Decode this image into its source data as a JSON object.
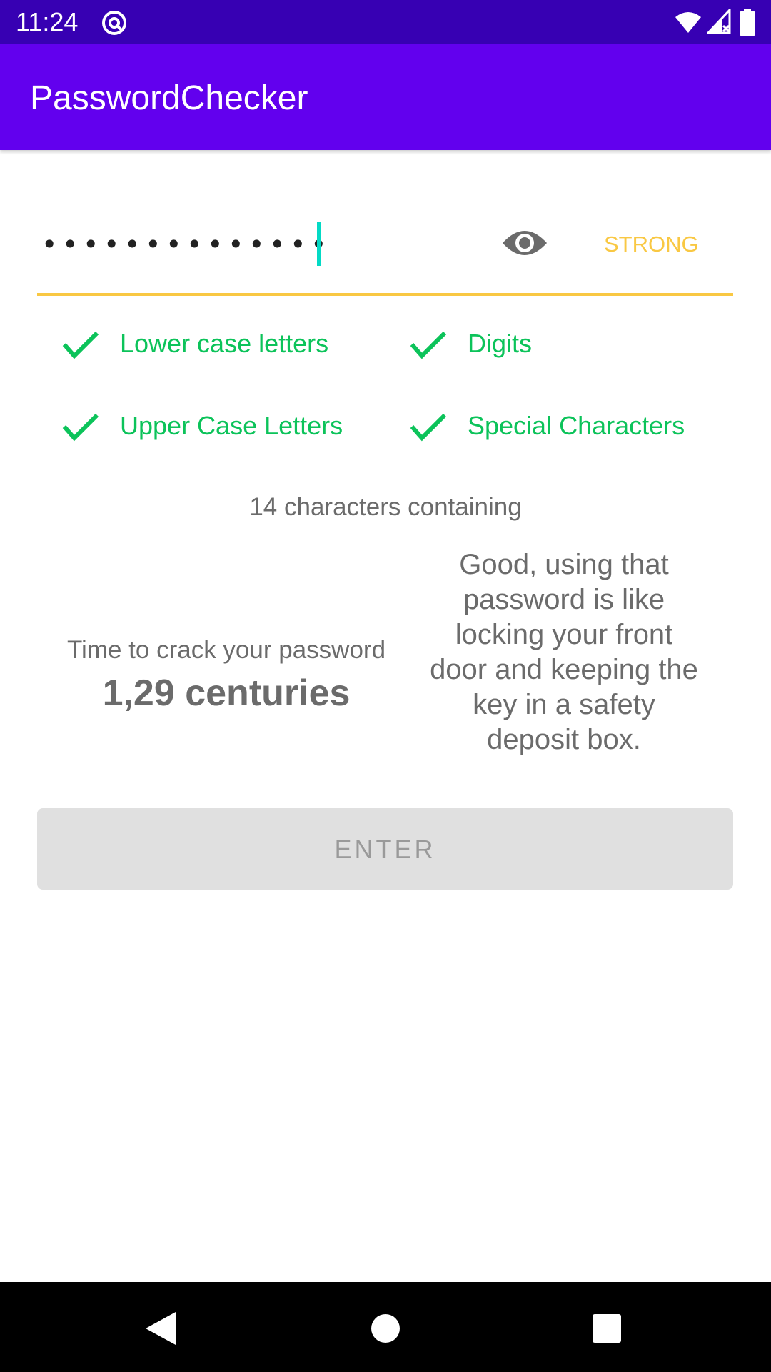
{
  "status_bar": {
    "time": "11:24",
    "icons": [
      "at-sign-icon",
      "wifi-icon",
      "signal-icon",
      "battery-icon"
    ]
  },
  "app_bar": {
    "title": "PasswordChecker"
  },
  "password_field": {
    "masked_value": "••••••••••••••",
    "visibility_icon": "eye-icon",
    "strength": "STRONG"
  },
  "criteria": [
    {
      "label": "Lower case letters",
      "met": true
    },
    {
      "label": "Digits",
      "met": true
    },
    {
      "label": "Upper Case Letters",
      "met": true
    },
    {
      "label": "Special Characters",
      "met": true
    }
  ],
  "summary": {
    "characters": "14 characters containing",
    "crack_label": "Time to crack your password",
    "crack_time": "1,29 centuries",
    "advice": "Good, using that password is like locking your front door and keeping the key in a safety deposit box."
  },
  "enter_button": {
    "label": "ENTER"
  },
  "nav_bar": {
    "buttons": [
      "back-icon",
      "home-icon",
      "recents-icon"
    ]
  },
  "colors": {
    "status_bar": "#3700b3",
    "app_bar": "#6200ee",
    "strength": "#f9c843",
    "check": "#0cc35a",
    "cursor": "#03dac5",
    "muted_text": "#6b6b6b",
    "button_bg": "#e0e0e0"
  }
}
